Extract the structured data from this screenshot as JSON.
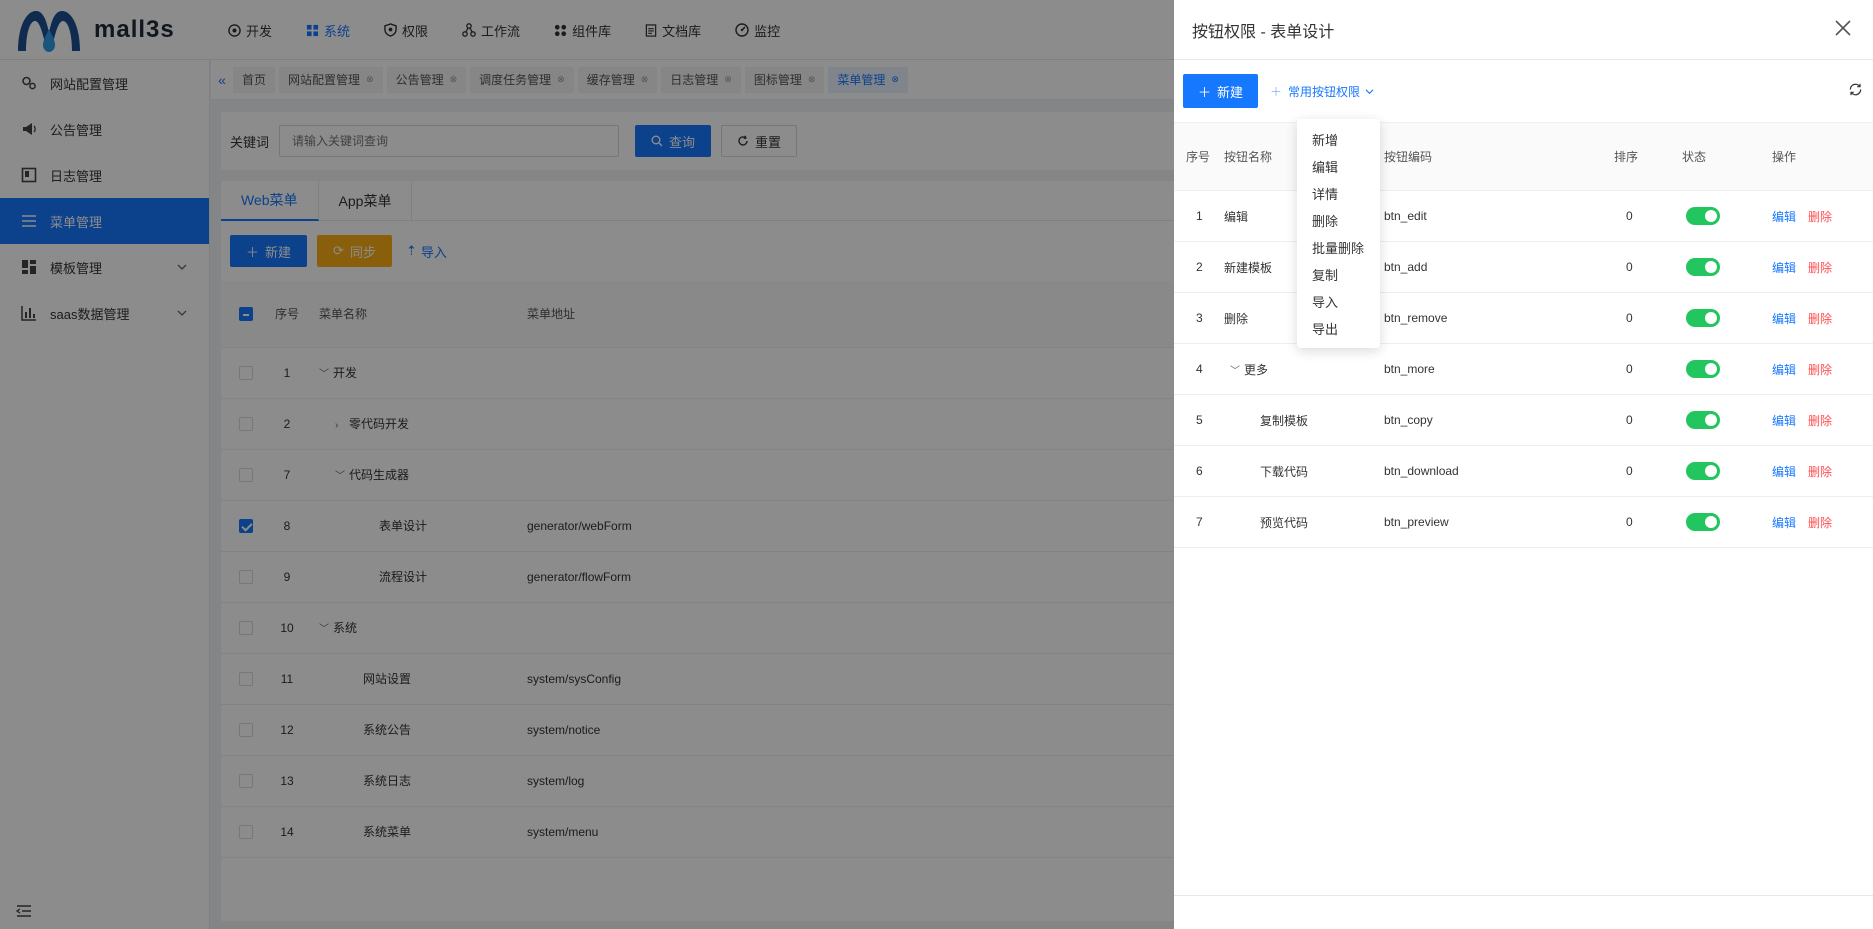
{
  "app": {
    "logo_text": "mall3s"
  },
  "topnav": [
    {
      "label": "开发",
      "icon": "dev-icon"
    },
    {
      "label": "系统",
      "icon": "grid-icon",
      "active": true
    },
    {
      "label": "权限",
      "icon": "shield-icon"
    },
    {
      "label": "工作流",
      "icon": "workflow-icon"
    },
    {
      "label": "组件库",
      "icon": "component-icon"
    },
    {
      "label": "文档库",
      "icon": "doc-icon"
    },
    {
      "label": "监控",
      "icon": "monitor-icon"
    }
  ],
  "sidebar": {
    "items": [
      {
        "label": "网站配置管理",
        "icon": "settings-icon"
      },
      {
        "label": "公告管理",
        "icon": "megaphone-icon"
      },
      {
        "label": "日志管理",
        "icon": "log-icon"
      },
      {
        "label": "菜单管理",
        "icon": "menu-icon",
        "active": true
      },
      {
        "label": "模板管理",
        "icon": "template-icon",
        "expandable": true
      },
      {
        "label": "saas数据管理",
        "icon": "chart-icon",
        "expandable": true
      }
    ]
  },
  "tags": [
    {
      "label": "首页",
      "closable": false
    },
    {
      "label": "网站配置管理",
      "closable": true
    },
    {
      "label": "公告管理",
      "closable": true
    },
    {
      "label": "调度任务管理",
      "closable": true
    },
    {
      "label": "缓存管理",
      "closable": true
    },
    {
      "label": "日志管理",
      "closable": true
    },
    {
      "label": "图标管理",
      "closable": true
    },
    {
      "label": "菜单管理",
      "closable": true,
      "active": true
    }
  ],
  "search": {
    "keyword_label": "关键词",
    "placeholder": "请输入关键词查询",
    "query_label": "查询",
    "reset_label": "重置"
  },
  "main": {
    "tabs": [
      {
        "label": "Web菜单",
        "active": true
      },
      {
        "label": "App菜单"
      }
    ],
    "toolbar": {
      "new_label": "新建",
      "sync_label": "同步",
      "import_label": "导入"
    },
    "columns": {
      "no": "序号",
      "name": "菜单名称",
      "url": "菜单地址"
    },
    "rows": [
      {
        "no": "1",
        "name": "开发",
        "url": "",
        "level": 0,
        "arrow": "open",
        "checked": false
      },
      {
        "no": "2",
        "name": "零代码开发",
        "url": "",
        "level": 1,
        "arrow": "closed",
        "checked": false
      },
      {
        "no": "7",
        "name": "代码生成器",
        "url": "",
        "level": 1,
        "arrow": "open",
        "checked": false
      },
      {
        "no": "8",
        "name": "表单设计",
        "url": "generator/webForm",
        "level": 2,
        "arrow": "",
        "checked": true
      },
      {
        "no": "9",
        "name": "流程设计",
        "url": "generator/flowForm",
        "level": 2,
        "arrow": "",
        "checked": false
      },
      {
        "no": "10",
        "name": "系统",
        "url": "",
        "level": 0,
        "arrow": "open",
        "checked": false
      },
      {
        "no": "11",
        "name": "网站设置",
        "url": "system/sysConfig",
        "level": 1,
        "arrow": "",
        "checked": false
      },
      {
        "no": "12",
        "name": "系统公告",
        "url": "system/notice",
        "level": 1,
        "arrow": "",
        "checked": false
      },
      {
        "no": "13",
        "name": "系统日志",
        "url": "system/log",
        "level": 1,
        "arrow": "",
        "checked": false
      },
      {
        "no": "14",
        "name": "系统菜单",
        "url": "system/menu",
        "level": 1,
        "arrow": "",
        "checked": false
      }
    ]
  },
  "drawer": {
    "title": "按钮权限 - 表单设计",
    "new_label": "新建",
    "common_perm_label": "常用按钮权限",
    "columns": {
      "no": "序号",
      "name": "按钮名称",
      "code": "按钮编码",
      "sort": "排序",
      "status": "状态",
      "ops": "操作"
    },
    "rows": [
      {
        "no": "1",
        "name": "编辑",
        "code": "btn_edit",
        "sort": "0",
        "level": 0,
        "arrow": ""
      },
      {
        "no": "2",
        "name": "新建模板",
        "code": "btn_add",
        "sort": "0",
        "level": 0,
        "arrow": ""
      },
      {
        "no": "3",
        "name": "删除",
        "code": "btn_remove",
        "sort": "0",
        "level": 0,
        "arrow": ""
      },
      {
        "no": "4",
        "name": "更多",
        "code": "btn_more",
        "sort": "0",
        "level": 0,
        "arrow": "open"
      },
      {
        "no": "5",
        "name": "复制模板",
        "code": "btn_copy",
        "sort": "0",
        "level": 1,
        "arrow": ""
      },
      {
        "no": "6",
        "name": "下载代码",
        "code": "btn_download",
        "sort": "0",
        "level": 1,
        "arrow": ""
      },
      {
        "no": "7",
        "name": "预览代码",
        "code": "btn_preview",
        "sort": "0",
        "level": 1,
        "arrow": ""
      }
    ],
    "op_edit": "编辑",
    "op_delete": "删除"
  },
  "dropdown": {
    "items": [
      "新增",
      "编辑",
      "详情",
      "删除",
      "批量删除",
      "复制",
      "导入",
      "导出"
    ]
  },
  "colors": {
    "primary": "#1677ff",
    "warning": "#faad14",
    "danger": "#ff4d4f",
    "switch_on": "#22c55e"
  }
}
